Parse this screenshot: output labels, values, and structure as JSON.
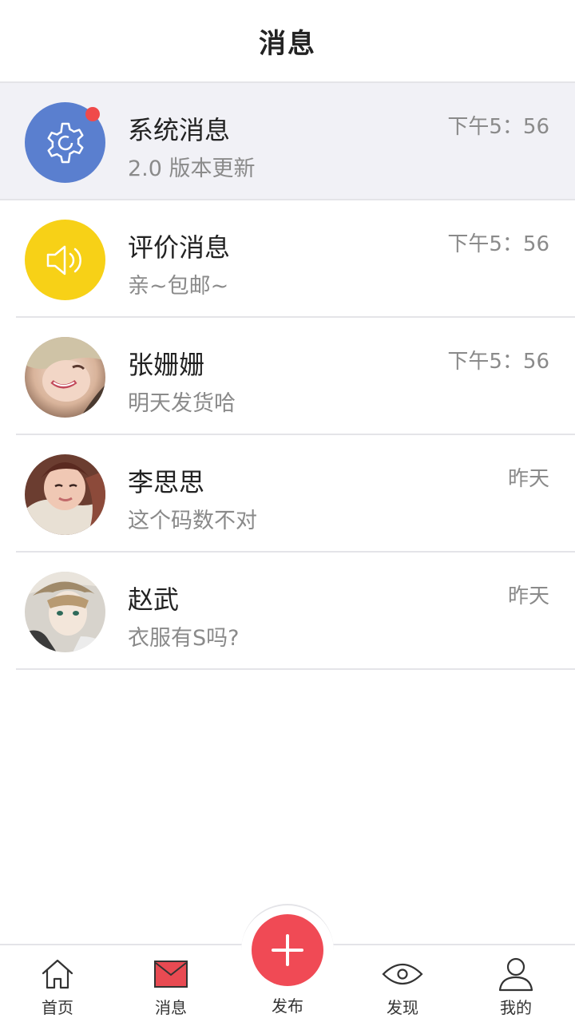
{
  "header": {
    "title": "消息"
  },
  "messages": [
    {
      "name": "系统消息",
      "preview": "2.0 版本更新",
      "time": "下午5：56",
      "avatar_icon": "gear-icon",
      "avatar_color": "#5a7fcf",
      "unread": true
    },
    {
      "name": "评价消息",
      "preview": "亲~包邮~",
      "time": "下午5：56",
      "avatar_icon": "speaker-icon",
      "avatar_color": "#f7d117"
    },
    {
      "name": "张姗姗",
      "preview": "明天发货哈",
      "time": "下午5：56",
      "avatar_icon": "user-photo"
    },
    {
      "name": "李思思",
      "preview": "这个码数不对",
      "time": "昨天",
      "avatar_icon": "user-photo"
    },
    {
      "name": "赵武",
      "preview": "衣服有S吗?",
      "time": "昨天",
      "avatar_icon": "user-photo"
    }
  ],
  "tabbar": {
    "home": "首页",
    "messages": "消息",
    "publish": "发布",
    "discover": "发现",
    "mine": "我的"
  },
  "colors": {
    "accent": "#f04a55",
    "highlight_row": "#f1f1f6",
    "badge": "#f04a4a"
  }
}
